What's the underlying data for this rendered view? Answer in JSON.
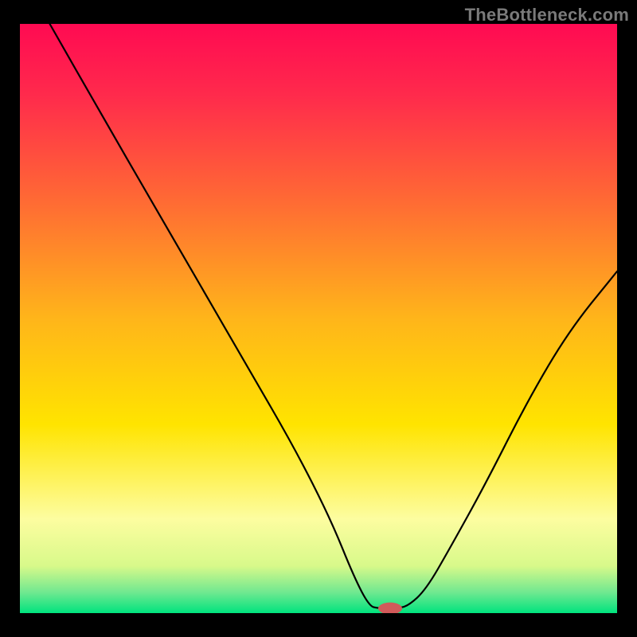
{
  "watermark": "TheBottleneck.com",
  "chart_data": {
    "type": "line",
    "title": "",
    "xlabel": "",
    "ylabel": "",
    "xlim": [
      0,
      100
    ],
    "ylim": [
      0,
      100
    ],
    "gradient_stops": [
      {
        "offset": 0.0,
        "color": "#ff0a52"
      },
      {
        "offset": 0.12,
        "color": "#ff2a4c"
      },
      {
        "offset": 0.3,
        "color": "#ff6a34"
      },
      {
        "offset": 0.5,
        "color": "#ffb51a"
      },
      {
        "offset": 0.68,
        "color": "#ffe400"
      },
      {
        "offset": 0.84,
        "color": "#fdfda0"
      },
      {
        "offset": 0.92,
        "color": "#d8f98a"
      },
      {
        "offset": 0.965,
        "color": "#6fe890"
      },
      {
        "offset": 1.0,
        "color": "#00e37e"
      }
    ],
    "marker": {
      "x": 62,
      "y": 0.8,
      "rx": 2.0,
      "ry": 1.0,
      "color": "#d15a5a"
    },
    "series": [
      {
        "name": "curve",
        "color": "#000000",
        "width": 2.2,
        "points": [
          {
            "x": 5,
            "y": 100
          },
          {
            "x": 14,
            "y": 84
          },
          {
            "x": 22,
            "y": 70
          },
          {
            "x": 30,
            "y": 56
          },
          {
            "x": 38,
            "y": 42
          },
          {
            "x": 46,
            "y": 28
          },
          {
            "x": 52,
            "y": 16
          },
          {
            "x": 56,
            "y": 6
          },
          {
            "x": 58.5,
            "y": 1.2
          },
          {
            "x": 60,
            "y": 0.8
          },
          {
            "x": 63,
            "y": 0.8
          },
          {
            "x": 65,
            "y": 1.2
          },
          {
            "x": 68,
            "y": 4
          },
          {
            "x": 72,
            "y": 11
          },
          {
            "x": 78,
            "y": 22
          },
          {
            "x": 85,
            "y": 36
          },
          {
            "x": 92,
            "y": 48
          },
          {
            "x": 100,
            "y": 58
          }
        ]
      }
    ]
  }
}
